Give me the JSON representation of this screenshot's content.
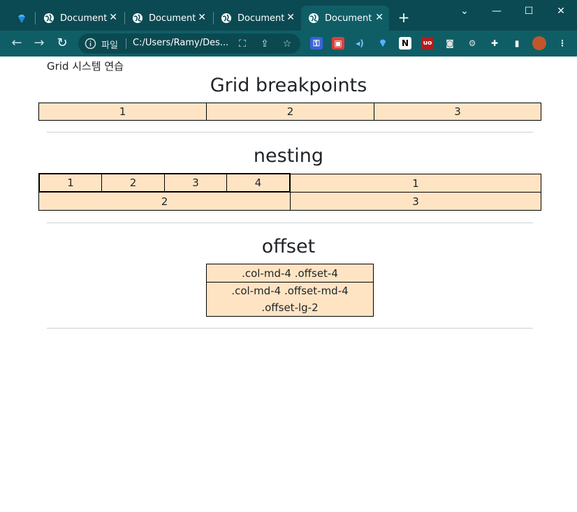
{
  "browser": {
    "tabs": [
      {
        "label": "Document"
      },
      {
        "label": "Document"
      },
      {
        "label": "Document"
      },
      {
        "label": "Document"
      }
    ],
    "new_tab": "+",
    "address": {
      "scheme": "파일",
      "url": "C:/Users/Ramy/Des..."
    },
    "colors": {
      "titlebar": "#0b4a52",
      "toolbar": "#0f5e66"
    }
  },
  "page": {
    "heading": "Grid 시스템 연습",
    "sections": {
      "breakpoints": {
        "title": "Grid breakpoints",
        "cells": [
          "1",
          "2",
          "3"
        ]
      },
      "nesting": {
        "title": "nesting",
        "inner_cells": [
          "1",
          "2",
          "3",
          "4"
        ],
        "row1_right": "1",
        "row2_left": "2",
        "row2_right": "3"
      },
      "offset": {
        "title": "offset",
        "cell1": ".col-md-4 .offset-4",
        "cell2_line1": ".col-md-4 .offset-md-4",
        "cell2_line2": ".offset-lg-2"
      }
    },
    "colors": {
      "cell_bg": "#ffe4c4",
      "cell_border": "#000000"
    }
  }
}
